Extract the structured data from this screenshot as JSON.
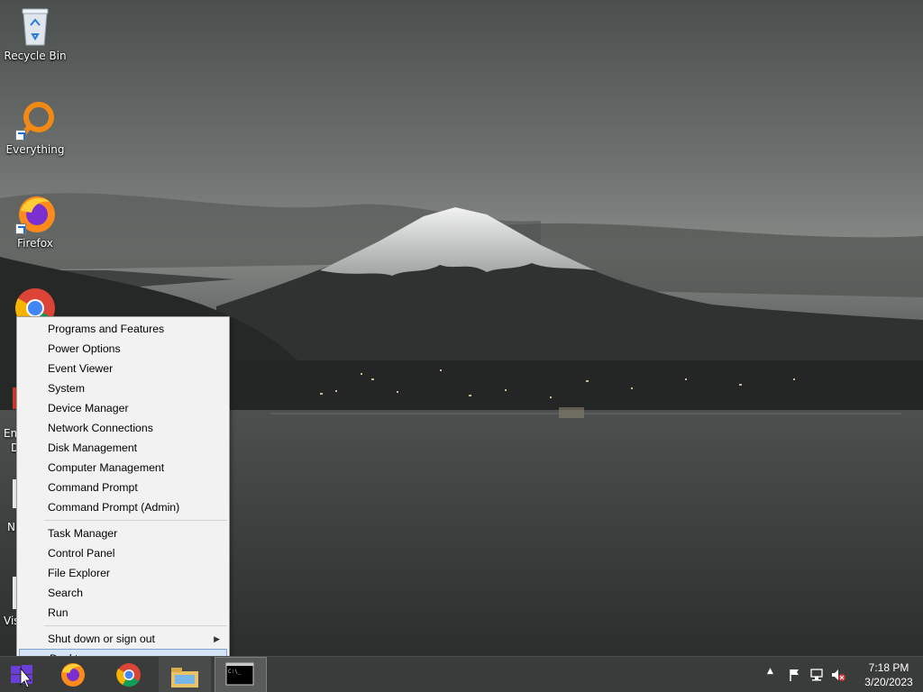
{
  "desktop": {
    "icons": [
      {
        "label": "Recycle Bin",
        "icon": "recycle-bin-icon"
      },
      {
        "label": "Everything",
        "icon": "everything-icon"
      },
      {
        "label": "Firefox",
        "icon": "firefox-icon"
      },
      {
        "label": "",
        "icon": "chrome-icon"
      }
    ],
    "peek_labels": [
      "Em",
      "D",
      "N",
      "Vis"
    ]
  },
  "context_menu": {
    "group1": [
      "Programs and Features",
      "Power Options",
      "Event Viewer",
      "System",
      "Device Manager",
      "Network Connections",
      "Disk Management",
      "Computer Management",
      "Command Prompt",
      "Command Prompt (Admin)"
    ],
    "group2": [
      "Task Manager",
      "Control Panel",
      "File Explorer",
      "Search",
      "Run"
    ],
    "group3": [
      {
        "label": "Shut down or sign out",
        "submenu": true
      },
      {
        "label": "Desktop",
        "selected": true
      }
    ]
  },
  "taskbar": {
    "apps": [
      {
        "name": "firefox-icon"
      },
      {
        "name": "chrome-icon"
      },
      {
        "name": "file-explorer-icon"
      },
      {
        "name": "command-prompt-icon",
        "active": true
      }
    ],
    "tray": {
      "time": "7:18 PM",
      "date": "3/20/2023",
      "icons": [
        "show-hidden-icons-chevron",
        "action-center-flag-icon",
        "network-icon",
        "volume-muted-icon"
      ]
    }
  },
  "colors": {
    "menu_bg": "#f2f2f2",
    "menu_selected": "#d5e5f5",
    "taskbar_bg": "#3a3c3b"
  }
}
